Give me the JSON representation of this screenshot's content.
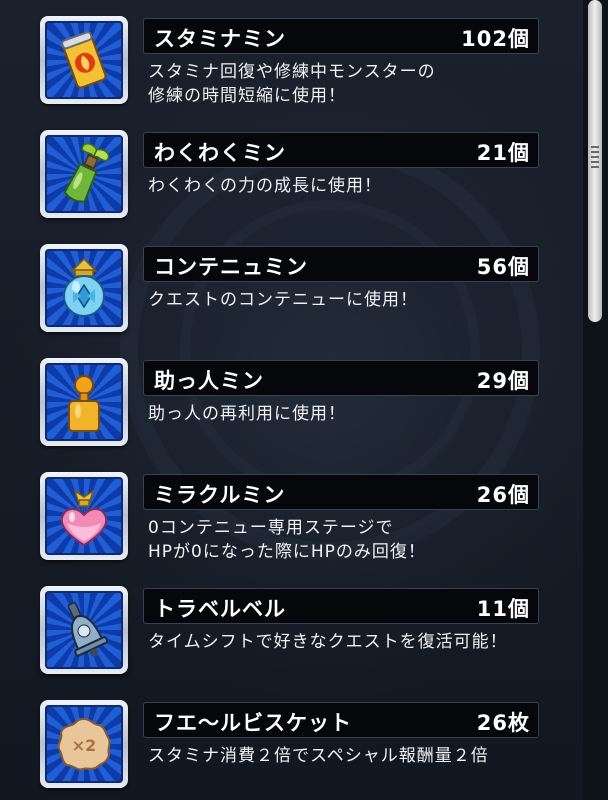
{
  "items": [
    {
      "name": "スタミナミン",
      "count": "102個",
      "description": "スタミナ回復や修練中モンスターの\n修練の時間短縮に使用！",
      "icon": "stamina-can-icon",
      "icon_color": "#f2c230"
    },
    {
      "name": "わくわくミン",
      "count": "21個",
      "description": "わくわくの力の成長に使用！",
      "icon": "sprout-bottle-icon",
      "icon_color": "#6fb63a"
    },
    {
      "name": "コンテニュミン",
      "count": "56個",
      "description": "クエストのコンテニューに使用！",
      "icon": "crystal-jar-icon",
      "icon_color": "#7fd3f2"
    },
    {
      "name": "助っ人ミン",
      "count": "29個",
      "description": "助っ人の再利用に使用！",
      "icon": "helper-figure-icon",
      "icon_color": "#f0a418"
    },
    {
      "name": "ミラクルミン",
      "count": "26個",
      "description": "0コンテニュー専用ステージで\nHPが0になった際にHPのみ回復！",
      "icon": "heart-potion-icon",
      "icon_color": "#f28ab8"
    },
    {
      "name": "トラベルベル",
      "count": "11個",
      "description": "タイムシフトで好きなクエストを復活可能！",
      "icon": "bell-icon",
      "icon_color": "#8fb0c8"
    },
    {
      "name": "フエ〜ルビスケット",
      "count": "26枚",
      "description": "スタミナ消費２倍でスペシャル報酬量２倍",
      "icon": "biscuit-icon",
      "icon_color": "#e9c69a",
      "icon_text": "×2"
    }
  ],
  "colors": {
    "background": "#141a24",
    "icon_ray_light": "#1e5fd8",
    "icon_ray_dark": "#0f3ba8",
    "name_bar": "#05070a",
    "text": "#ffffff"
  }
}
